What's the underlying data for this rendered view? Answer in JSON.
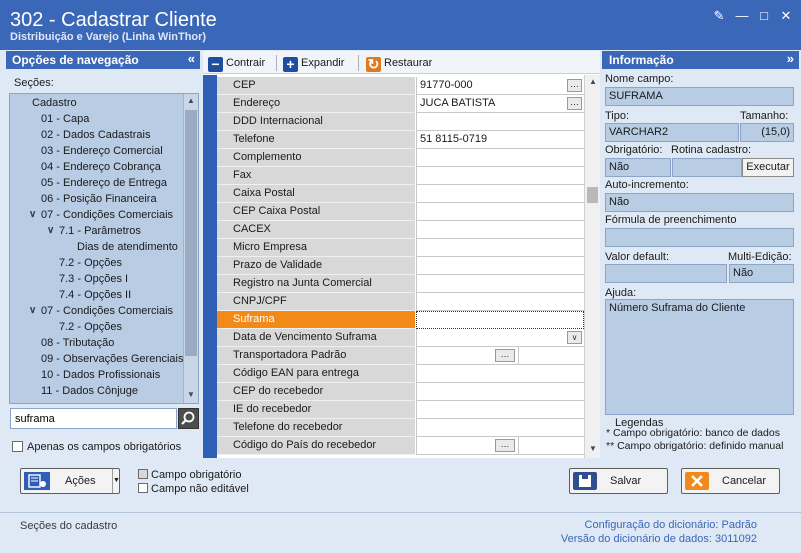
{
  "window": {
    "title": "302 - Cadastrar Cliente",
    "subtitle": "Distribuição e Varejo (Linha WinThor)"
  },
  "nav": {
    "header": "Opções de navegação",
    "sections_label": "Seções:",
    "tree": [
      {
        "label": "Cadastro",
        "level": 0,
        "expander": ""
      },
      {
        "label": "01 - Capa",
        "level": 1,
        "expander": ""
      },
      {
        "label": "02 - Dados Cadastrais",
        "level": 1,
        "expander": ""
      },
      {
        "label": "03 - Endereço Comercial",
        "level": 1,
        "expander": ""
      },
      {
        "label": "04 - Endereço Cobrança",
        "level": 1,
        "expander": ""
      },
      {
        "label": "05 - Endereço de Entrega",
        "level": 1,
        "expander": ""
      },
      {
        "label": "06 - Posição Financeira",
        "level": 1,
        "expander": ""
      },
      {
        "label": "07 - Condições Comerciais",
        "level": 1,
        "expander": "v"
      },
      {
        "label": "7.1 - Parâmetros",
        "level": 2,
        "expander": "v"
      },
      {
        "label": "Dias de atendimento",
        "level": 3,
        "expander": ""
      },
      {
        "label": "7.2 - Opções",
        "level": 2,
        "expander": ""
      },
      {
        "label": "7.3 - Opções I",
        "level": 2,
        "expander": ""
      },
      {
        "label": "7.4 - Opções II",
        "level": 2,
        "expander": ""
      },
      {
        "label": "07 - Condições Comerciais",
        "level": 1,
        "expander": "v"
      },
      {
        "label": "7.2 - Opções",
        "level": 2,
        "expander": ""
      },
      {
        "label": "08 - Tributação",
        "level": 1,
        "expander": ""
      },
      {
        "label": "09 - Observações Gerenciais",
        "level": 1,
        "expander": ""
      },
      {
        "label": "10 - Dados Profissionais",
        "level": 1,
        "expander": ""
      },
      {
        "label": "11 - Dados Cônjuge",
        "level": 1,
        "expander": ""
      }
    ],
    "search_value": "suframa",
    "mandatory_only_label": "Apenas os campos obrigatórios"
  },
  "toolbar": {
    "collapse_label": "Contrair",
    "expand_label": "Expandir",
    "restore_label": "Restaurar"
  },
  "grid": {
    "rows": [
      {
        "label": "CEP",
        "value": "91770-000",
        "control": "ellipsis"
      },
      {
        "label": "Endereço",
        "value": "JUCA BATISTA",
        "control": "ellipsis"
      },
      {
        "label": "DDD Internacional",
        "value": "",
        "control": ""
      },
      {
        "label": "Telefone",
        "value": "51 8115-0719",
        "control": ""
      },
      {
        "label": "Complemento",
        "value": "",
        "control": ""
      },
      {
        "label": "Fax",
        "value": "",
        "control": ""
      },
      {
        "label": "Caixa Postal",
        "value": "",
        "control": ""
      },
      {
        "label": "CEP Caixa Postal",
        "value": "",
        "control": ""
      },
      {
        "label": "CACEX",
        "value": "",
        "control": ""
      },
      {
        "label": "Micro Empresa",
        "value": "",
        "control": ""
      },
      {
        "label": "Prazo de Validade",
        "value": "",
        "control": ""
      },
      {
        "label": "Registro na Junta Comercial",
        "value": "",
        "control": ""
      },
      {
        "label": "CNPJ/CPF",
        "value": "",
        "control": ""
      },
      {
        "label": "Suframa",
        "value": "",
        "control": "",
        "selected": true
      },
      {
        "label": "Data de Vencimento Suframa",
        "value": "",
        "control": "dropdown"
      },
      {
        "label": "Transportadora Padrão",
        "value": "",
        "control": "ellipsis-mid"
      },
      {
        "label": "Código EAN para entrega",
        "value": "",
        "control": ""
      },
      {
        "label": "CEP do recebedor",
        "value": "",
        "control": ""
      },
      {
        "label": "IE do recebedor",
        "value": "",
        "control": ""
      },
      {
        "label": "Telefone do recebedor",
        "value": "",
        "control": ""
      },
      {
        "label": "Código do País do recebedor",
        "value": "",
        "control": "ellipsis-mid"
      }
    ]
  },
  "info": {
    "header": "Informação",
    "field_name_label": "Nome campo:",
    "field_name_value": "SUFRAMA",
    "type_label": "Tipo:",
    "type_value": "VARCHAR2",
    "size_label": "Tamanho:",
    "size_value": "(15,0)",
    "required_label": "Obrigatório:",
    "required_value": "Não",
    "routine_label": "Rotina cadastro:",
    "execute_label": "Executar",
    "autoinc_label": "Auto-incremento:",
    "autoinc_value": "Não",
    "formula_label": "Fórmula de preenchimento",
    "formula_value": "",
    "default_label": "Valor default:",
    "default_value": "",
    "multiedit_label": "Multi-Edição:",
    "multiedit_value": "Não",
    "help_label": "Ajuda:",
    "help_value": "Número Suframa do Cliente",
    "legend_title": "Legendas",
    "legend_1": "* Campo obrigatório: banco de dados",
    "legend_2": "** Campo obrigatório: definido manual"
  },
  "footer": {
    "actions_label": "Ações",
    "legend_mandatory": "Campo obrigatório",
    "legend_not_editable": "Campo não editável",
    "save_label": "Salvar",
    "cancel_label": "Cancelar",
    "status_left": "Seções do cadastro",
    "dict_config": "Configuração do dicionário: Padrão",
    "dict_version": "Versão do dicionário de dados: 3011092"
  },
  "colors": {
    "title_blue": "#3b67b8",
    "selected_orange": "#f28a18",
    "panel_bg": "#dfe8f5"
  }
}
